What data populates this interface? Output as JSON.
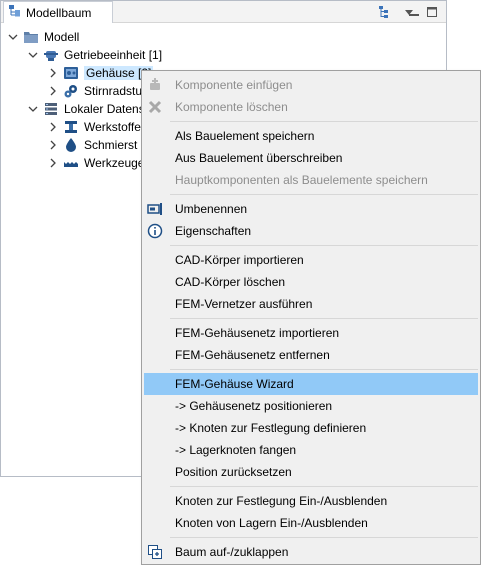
{
  "view": {
    "title": "Modellbaum",
    "toolbar": [
      "tree-toggle-icon",
      "view-menu-icon",
      "minimize-icon",
      "maximize-icon"
    ]
  },
  "tree": [
    {
      "label": "Modell",
      "icon": "folder-icon",
      "expanded": true
    },
    {
      "label": "Getriebeeinheit [1]",
      "icon": "gear-unit-icon",
      "expanded": true
    },
    {
      "label": "Gehäuse [2]",
      "icon": "housing-icon",
      "expanded": false,
      "selected": true
    },
    {
      "label": "Stirnradstu",
      "icon": "spur-gear-icon",
      "expanded": false
    },
    {
      "label": "Lokaler Datens",
      "icon": "database-icon",
      "expanded": true
    },
    {
      "label": "Werkstoffe",
      "icon": "material-icon",
      "expanded": false
    },
    {
      "label": "Schmierst",
      "icon": "lubricant-icon",
      "expanded": false
    },
    {
      "label": "Werkzeuge",
      "icon": "tool-icon",
      "expanded": false
    }
  ],
  "menu": {
    "items": [
      {
        "label": "Komponente einfügen",
        "icon": "insert-component-icon",
        "disabled": true
      },
      {
        "label": "Komponente löschen",
        "icon": "delete-x-icon",
        "disabled": true
      },
      {
        "separator": true
      },
      {
        "label": "Als Bauelement speichern"
      },
      {
        "label": "Aus Bauelement überschreiben"
      },
      {
        "label": "Hauptkomponenten als Bauelemente speichern",
        "disabled": true
      },
      {
        "separator": true
      },
      {
        "label": "Umbenennen",
        "icon": "rename-icon"
      },
      {
        "label": "Eigenschaften",
        "icon": "info-icon"
      },
      {
        "separator": true
      },
      {
        "label": "CAD-Körper importieren"
      },
      {
        "label": "CAD-Körper löschen"
      },
      {
        "label": "FEM-Vernetzer ausführen"
      },
      {
        "separator": true
      },
      {
        "label": "FEM-Gehäusenetz importieren"
      },
      {
        "label": "FEM-Gehäusenetz entfernen"
      },
      {
        "separator": true
      },
      {
        "label": "FEM-Gehäuse Wizard",
        "highlighted": true
      },
      {
        "label": "->  Gehäusenetz positionieren"
      },
      {
        "label": "->  Knoten zur Festlegung definieren"
      },
      {
        "label": "->  Lagerknoten fangen"
      },
      {
        "label": "Position zurücksetzen"
      },
      {
        "separator": true
      },
      {
        "label": "Knoten zur Festlegung Ein-/Ausblenden"
      },
      {
        "label": "Knoten von Lagern Ein-/Ausblenden"
      },
      {
        "separator": true
      },
      {
        "label": "Baum auf-/zuklappen",
        "icon": "expand-collapse-icon"
      }
    ]
  }
}
